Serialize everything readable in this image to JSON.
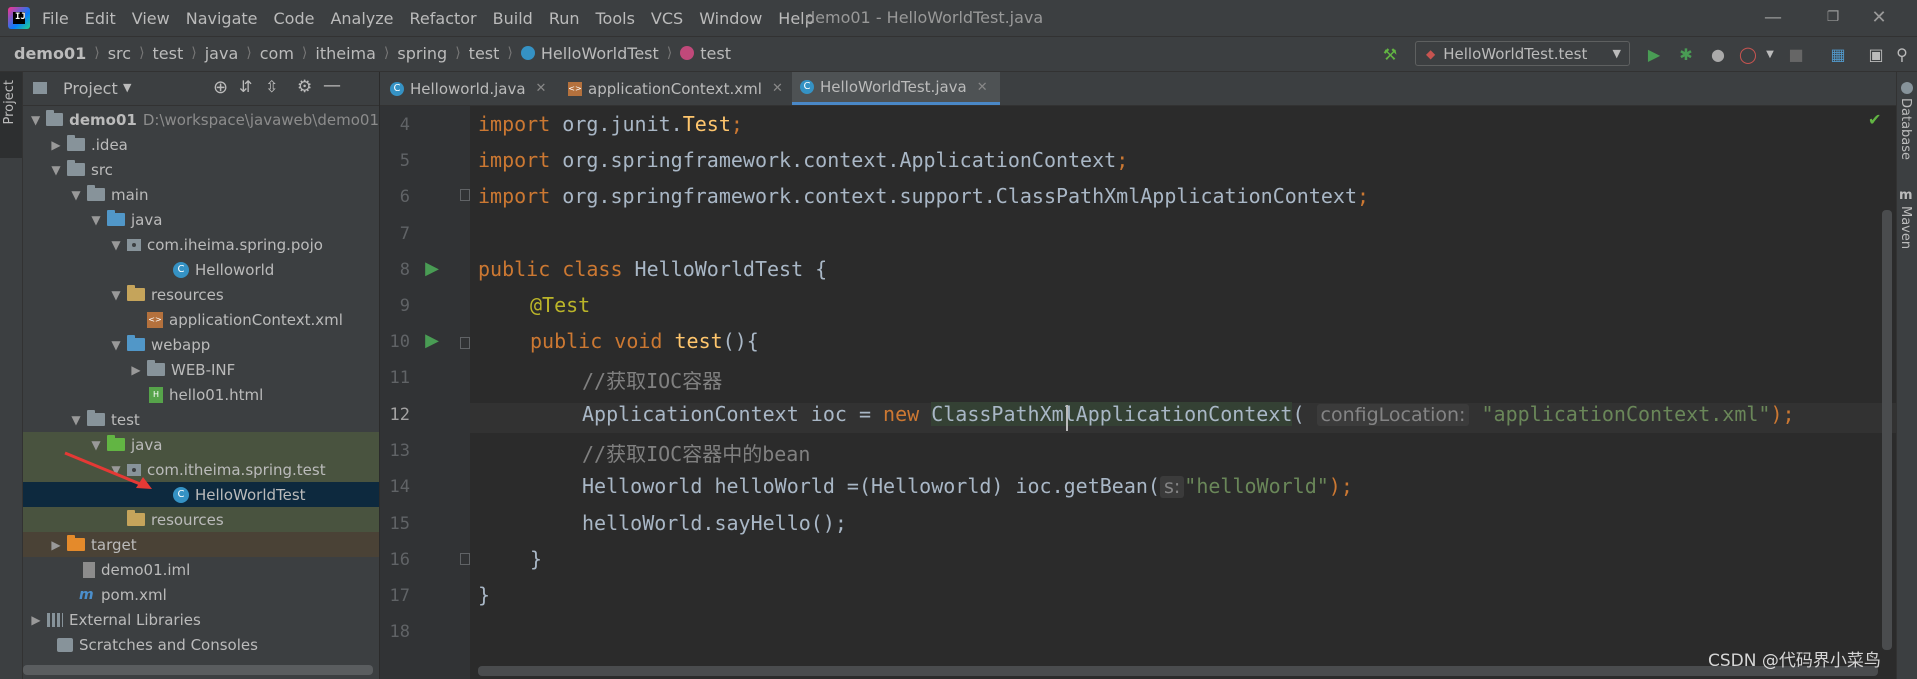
{
  "menu": [
    "File",
    "Edit",
    "View",
    "Navigate",
    "Code",
    "Analyze",
    "Refactor",
    "Build",
    "Run",
    "Tools",
    "VCS",
    "Window",
    "Help"
  ],
  "window_title": "demo01 - HelloWorldTest.java",
  "breadcrumbs": [
    "demo01",
    "src",
    "test",
    "java",
    "com",
    "itheima",
    "spring",
    "test",
    "HelloWorldTest",
    "test"
  ],
  "run_config": "HelloWorldTest.test",
  "project_panel": {
    "title": "Project",
    "tree": [
      {
        "label": "demo01",
        "path": "D:\\workspace\\javaweb\\demo01"
      },
      {
        "label": ".idea"
      },
      {
        "label": "src"
      },
      {
        "label": "main"
      },
      {
        "label": "java"
      },
      {
        "label": "com.iheima.spring.pojo"
      },
      {
        "label": "Helloworld"
      },
      {
        "label": "resources"
      },
      {
        "label": "applicationContext.xml"
      },
      {
        "label": "webapp"
      },
      {
        "label": "WEB-INF"
      },
      {
        "label": "hello01.html"
      },
      {
        "label": "test"
      },
      {
        "label": "java"
      },
      {
        "label": "com.itheima.spring.test"
      },
      {
        "label": "HelloWorldTest"
      },
      {
        "label": "resources"
      },
      {
        "label": "target"
      },
      {
        "label": "demo01.iml"
      },
      {
        "label": "pom.xml"
      },
      {
        "label": "External Libraries"
      },
      {
        "label": "Scratches and Consoles"
      }
    ]
  },
  "side_tabs": {
    "left": "Project",
    "right": [
      "Database",
      "Maven"
    ]
  },
  "editor_tabs": [
    {
      "label": "Helloworld.java"
    },
    {
      "label": "applicationContext.xml"
    },
    {
      "label": "HelloWorldTest.java"
    }
  ],
  "line_numbers": [
    "4",
    "5",
    "6",
    "7",
    "8",
    "9",
    "10",
    "11",
    "12",
    "13",
    "14",
    "15",
    "16",
    "17",
    "18"
  ],
  "code": {
    "l4": {
      "kw": "import ",
      "rest": "org.junit.",
      "cls": "Test",
      ";": ";"
    },
    "l5": {
      "kw": "import ",
      "rest": "org.springframework.context.ApplicationContext",
      ";": ";"
    },
    "l6": {
      "kw": "import ",
      "rest": "org.springframework.context.support.ClassPathXmlApplicationContext",
      ";": ";"
    },
    "l8": {
      "kw": "public class ",
      "rest": "HelloWorldTest {"
    },
    "l9": {
      "an": "@Test"
    },
    "l10": {
      "kw": "public void ",
      "fn": "test",
      "rest": "(){"
    },
    "l11": {
      "cm": "//获取IOC容器"
    },
    "l12": {
      "a": "ApplicationContext ioc = ",
      "kw": "new ",
      "cls": "ClassPathXmlApplicationContext",
      "p": "(",
      "hint": "configLocation:",
      "str": "\"applicationContext.xml\"",
      "end": ");"
    },
    "l13": {
      "cm": "//获取IOC容器中的bean"
    },
    "l14": {
      "a": "Helloworld helloWorld =(Helloworld) ioc.getBean(",
      "hint": "s:",
      "str": "\"helloWorld\"",
      "end": ");"
    },
    "l15": {
      "a": "helloWorld.sayHello();"
    },
    "l16": {
      "a": "}"
    },
    "l17": {
      "a": "}"
    }
  },
  "watermark": "CSDN @代码界小菜鸟",
  "colors": {
    "accent": "#4a88c7",
    "keyword": "#cc7832",
    "string": "#6a8759",
    "comment": "#808080",
    "annotation": "#bbb529",
    "run_green": "#499c54"
  }
}
